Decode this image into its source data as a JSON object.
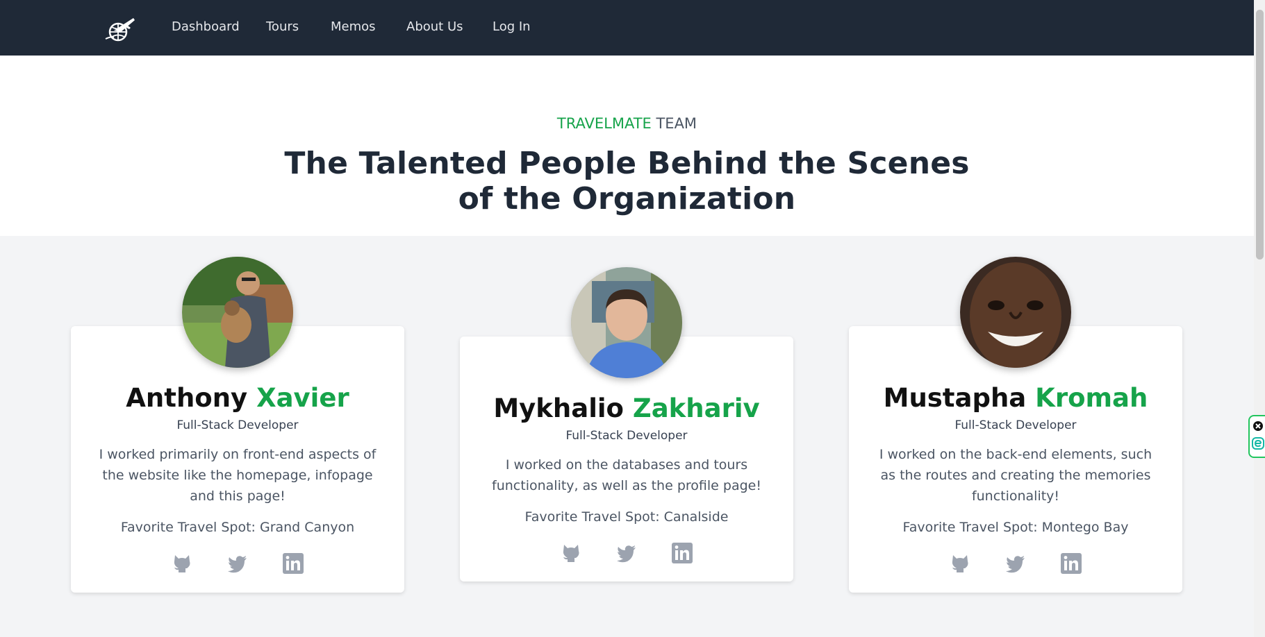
{
  "nav": {
    "logo_icon": "airplane-globe-icon",
    "links": [
      "Dashboard",
      "Tours",
      "Memos",
      "About Us",
      "Log In"
    ]
  },
  "hero": {
    "eyebrow_accent": "TRAVELMATE",
    "eyebrow_rest": " TEAM",
    "headline_line1": "The Talented People Behind the Scenes",
    "headline_line2": "of the Organization"
  },
  "team": [
    {
      "first_name": "Anthony",
      "last_name": "Xavier",
      "role": "Full-Stack Developer",
      "bio": "I worked primarily on front-end aspects of the website like the homepage, infopage and this page!",
      "favorite_spot": "Favorite Travel Spot: Grand Canyon",
      "socials": [
        "github-icon",
        "twitter-icon",
        "linkedin-icon"
      ]
    },
    {
      "first_name": "Mykhalio",
      "last_name": "Zakhariv",
      "role": "Full-Stack Developer",
      "bio": "I worked on the databases and tours functionality, as well as the profile page!",
      "favorite_spot": "Favorite Travel Spot: Canalside",
      "socials": [
        "github-icon",
        "twitter-icon",
        "linkedin-icon"
      ]
    },
    {
      "first_name": "Mustapha",
      "last_name": "Kromah",
      "role": "Full-Stack Developer",
      "bio": "I worked on the back-end elements, such as the routes and creating the memories functionality!",
      "favorite_spot": "Favorite Travel Spot: Montego Bay",
      "socials": [
        "github-icon",
        "twitter-icon",
        "linkedin-icon"
      ]
    }
  ],
  "colors": {
    "nav_bg": "#1f2937",
    "accent": "#16a34a",
    "icon_gray": "#9ca3af",
    "band_bg": "#f3f4f6"
  }
}
